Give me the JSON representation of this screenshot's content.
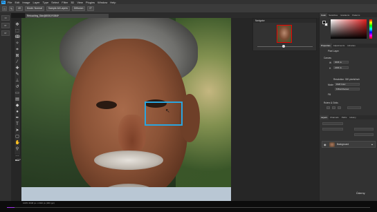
{
  "menubar": {
    "logo": "Ps",
    "items": [
      "File",
      "Edit",
      "Image",
      "Layer",
      "Type",
      "Select",
      "Filter",
      "3D",
      "View",
      "Plugins",
      "Window",
      "Help"
    ]
  },
  "options": {
    "brush_size": "40",
    "mode": "Mode: Normal",
    "sample_all": "Sample All Layers",
    "diffusion": "Diffusion",
    "angle": "0°"
  },
  "document_tab": "Retouching_Skin@8000,RGB/8*",
  "left_strip": {
    "buttons": [
      "Cl",
      "Pr",
      "Pr"
    ]
  },
  "navigator": {
    "title": "Navigator"
  },
  "right_panels": {
    "color_tabs": [
      "Color",
      "Swatches",
      "Gradients",
      "Patterns"
    ],
    "properties_tabs": [
      "Properties",
      "Adjustments",
      "Libraries"
    ],
    "pixel_layer": "Pixel Layer",
    "canvas_label": "Canvas",
    "w_value": "3645 px",
    "h_value": "2430 px",
    "resolution": "Resolution: 300 pixels/inch",
    "mode_label": "Mode",
    "mode_value": "RGB Color",
    "depth_value": "8 Bits/Channel",
    "fill_label": "Fill",
    "rulers_label": "Rulers & Grids",
    "layers_tabs": [
      "Layers",
      "Channels",
      "Paths",
      "History"
    ],
    "layer_name": "Background",
    "lock_icon": "lock-icon"
  },
  "watermark": "Ûdemy",
  "status": {
    "zoom": "100%     3648 px x 2432 px (300 ppi)"
  },
  "playback": {
    "progress": 0.02
  }
}
